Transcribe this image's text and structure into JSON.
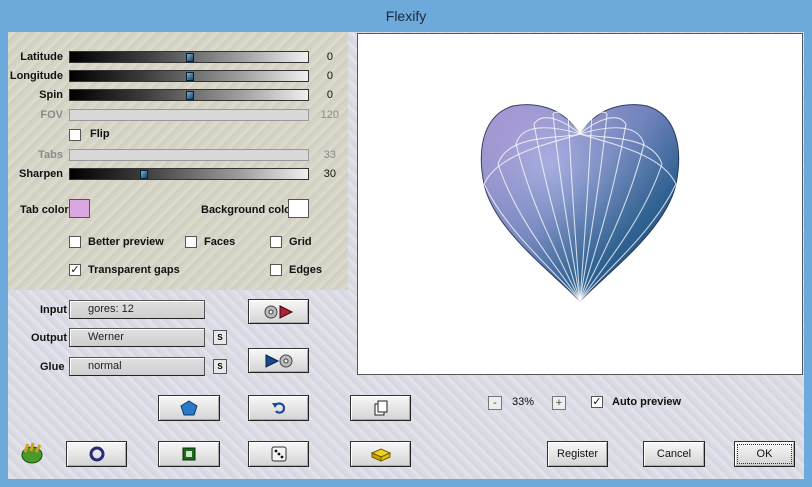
{
  "window": {
    "title": "Flexify"
  },
  "sliders": [
    {
      "label": "Latitude",
      "value": "0",
      "thumb_fraction": 0.5,
      "enabled": true
    },
    {
      "label": "Longitude",
      "value": "0",
      "thumb_fraction": 0.5,
      "enabled": true
    },
    {
      "label": "Spin",
      "value": "0",
      "thumb_fraction": 0.5,
      "enabled": true
    },
    {
      "label": "FOV",
      "value": "120",
      "enabled": false
    },
    {
      "label": "Tabs",
      "value": "33",
      "enabled": false
    },
    {
      "label": "Sharpen",
      "value": "30",
      "thumb_fraction": 0.3,
      "enabled": true
    }
  ],
  "flip": {
    "label": "Flip",
    "checked": false
  },
  "colors": {
    "tab_color_label": "Tab color",
    "tab_color": "#d9a8e0",
    "background_color_label": "Background color",
    "background_color": "#ffffff"
  },
  "options": {
    "better_preview": {
      "label": "Better preview",
      "checked": false
    },
    "faces": {
      "label": "Faces",
      "checked": false
    },
    "grid": {
      "label": "Grid",
      "checked": false
    },
    "transparent_gaps": {
      "label": "Transparent gaps",
      "checked": true
    },
    "edges": {
      "label": "Edges",
      "checked": false
    }
  },
  "projection": {
    "input_label": "Input",
    "input_value": "gores: 12",
    "output_label": "Output",
    "output_value": "Werner",
    "glue_label": "Glue",
    "glue_value": "normal",
    "settings_button_label": "S"
  },
  "zoom": {
    "minus": "-",
    "value": "33%",
    "plus": "+"
  },
  "auto_preview": {
    "label": "Auto preview",
    "checked": true
  },
  "buttons": {
    "register": "Register",
    "cancel": "Cancel",
    "ok": "OK"
  }
}
